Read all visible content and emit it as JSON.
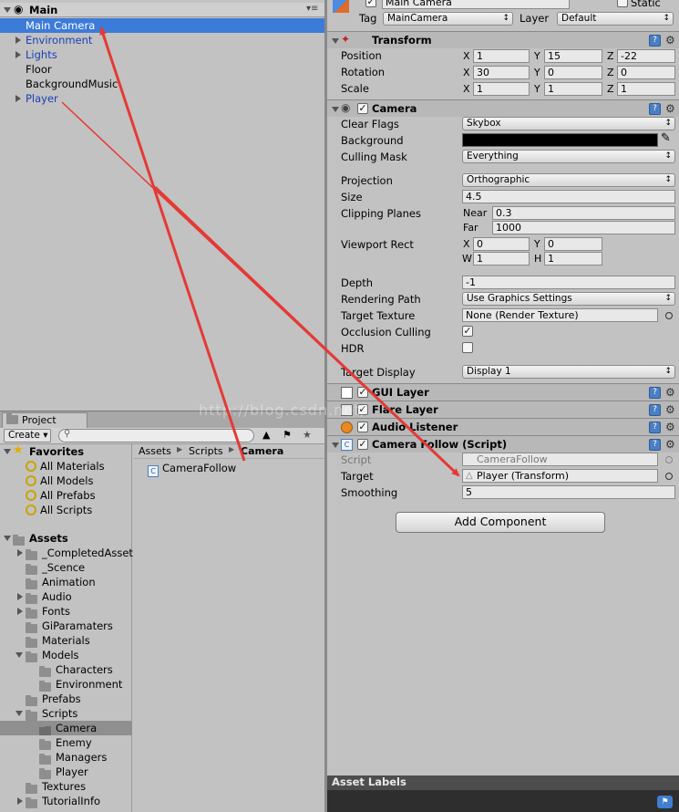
{
  "hierarchy": {
    "scene": "Main",
    "items": [
      {
        "label": "Main Camera",
        "selected": true
      },
      {
        "label": "Environment"
      },
      {
        "label": "Lights"
      },
      {
        "label": "Floor"
      },
      {
        "label": "BackgroundMusic"
      },
      {
        "label": "Player"
      }
    ]
  },
  "project": {
    "tab": "Project",
    "create_label": "Create",
    "favorites": {
      "label": "Favorites",
      "items": [
        "All Materials",
        "All Models",
        "All Prefabs",
        "All Scripts"
      ]
    },
    "assets": {
      "label": "Assets",
      "folders": [
        "_CompletedAssets",
        "_Scence",
        "Animation",
        "Audio",
        "Fonts",
        "GiParamaters",
        "Materials",
        "Models",
        "Characters",
        "Environment",
        "Prefabs",
        "Scripts",
        "Camera",
        "Enemy",
        "Managers",
        "Player",
        "Textures",
        "TutorialInfo"
      ]
    },
    "breadcrumb": [
      "Assets",
      "Scripts",
      "Camera"
    ],
    "files": [
      "CameraFollow"
    ],
    "watermark": "http://blog.csdn.net/"
  },
  "inspector": {
    "object_name": "Main Camera",
    "static_label": "Static",
    "tag_label": "Tag",
    "tag_value": "MainCamera",
    "layer_label": "Layer",
    "layer_value": "Default",
    "transform": {
      "title": "Transform",
      "position_label": "Position",
      "rotation_label": "Rotation",
      "scale_label": "Scale",
      "position": [
        "1",
        "15",
        "-22"
      ],
      "rotation": [
        "30",
        "0",
        "0"
      ],
      "scale": [
        "1",
        "1",
        "1"
      ],
      "axis_x": "X",
      "axis_y": "Y",
      "axis_z": "Z"
    },
    "camera": {
      "title": "Camera",
      "clear_flags_label": "Clear Flags",
      "clear_flags": "Skybox",
      "background_label": "Background",
      "background_color": "#000000",
      "culling_mask_label": "Culling Mask",
      "culling_mask": "Everything",
      "projection_label": "Projection",
      "projection": "Orthographic",
      "size_label": "Size",
      "size": "4.5",
      "clipping_label": "Clipping Planes",
      "near_label": "Near",
      "near": "0.3",
      "far_label": "Far",
      "far": "1000",
      "viewport_label": "Viewport Rect",
      "vp_x_label": "X",
      "vp_x": "0",
      "vp_y_label": "Y",
      "vp_y": "0",
      "vp_w_label": "W",
      "vp_w": "1",
      "vp_h_label": "H",
      "vp_h": "1",
      "depth_label": "Depth",
      "depth": "-1",
      "rendering_path_label": "Rendering Path",
      "rendering_path": "Use Graphics Settings",
      "target_texture_label": "Target Texture",
      "target_texture": "None (Render Texture)",
      "occlusion_label": "Occlusion Culling",
      "occlusion_checked": true,
      "hdr_label": "HDR",
      "hdr_checked": false,
      "target_display_label": "Target Display",
      "target_display": "Display 1"
    },
    "gui_layer": {
      "title": "GUI Layer"
    },
    "flare_layer": {
      "title": "Flare Layer"
    },
    "audio_listener": {
      "title": "Audio Listener"
    },
    "camera_follow": {
      "title": "Camera Follow (Script)",
      "script_label": "Script",
      "script_value": "CameraFollow",
      "target_label": "Target",
      "target_value": "Player (Transform)",
      "smoothing_label": "Smoothing",
      "smoothing_value": "5"
    },
    "add_component": "Add Component",
    "asset_labels": "Asset Labels"
  },
  "colors": {
    "selection": "#3d7bd8",
    "annotation_arrow": "#e53935",
    "link_text": "#1a3fb5"
  }
}
